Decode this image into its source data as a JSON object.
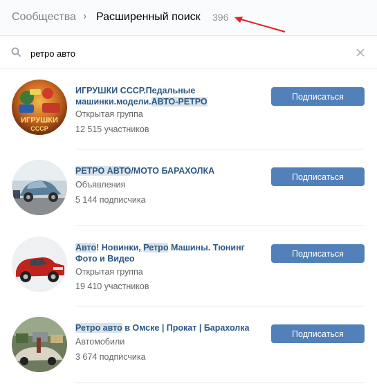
{
  "header": {
    "root": "Сообщества",
    "separator": "›",
    "current": "Расширенный поиск",
    "count": "396"
  },
  "search": {
    "value": "ретро авто"
  },
  "colors": {
    "accent": "#5181b8",
    "link": "#2a5885",
    "highlight": "#dae2ea",
    "arrow": "#e02020"
  },
  "results": [
    {
      "title_parts": [
        "ИГРУШКИ СССР.Педальные машинки.модели.",
        "АВТО-РЕТРО"
      ],
      "type": "Открытая группа",
      "members": "12 515 участников",
      "button": "Подписаться",
      "avatar_text_1": "ИГРУШКИ",
      "avatar_text_2": "СССР"
    },
    {
      "title_parts": [
        "РЕТРО АВТО",
        "/МОТО БАРАХОЛКА"
      ],
      "type": "Объявления",
      "members": "5 144 подписчика",
      "button": "Подписаться"
    },
    {
      "title_parts": [
        "Авто",
        "! Новинки, ",
        "Ретро",
        " Машины. Тюнинг Фото и Видео"
      ],
      "type": "Открытая группа",
      "members": "19 410 участников",
      "button": "Подписаться"
    },
    {
      "title_parts": [
        "Ретро авто",
        " в Омске | Прокат | Барахолка"
      ],
      "type": "Автомобили",
      "members": "3 674 подписчика",
      "button": "Подписаться"
    }
  ]
}
